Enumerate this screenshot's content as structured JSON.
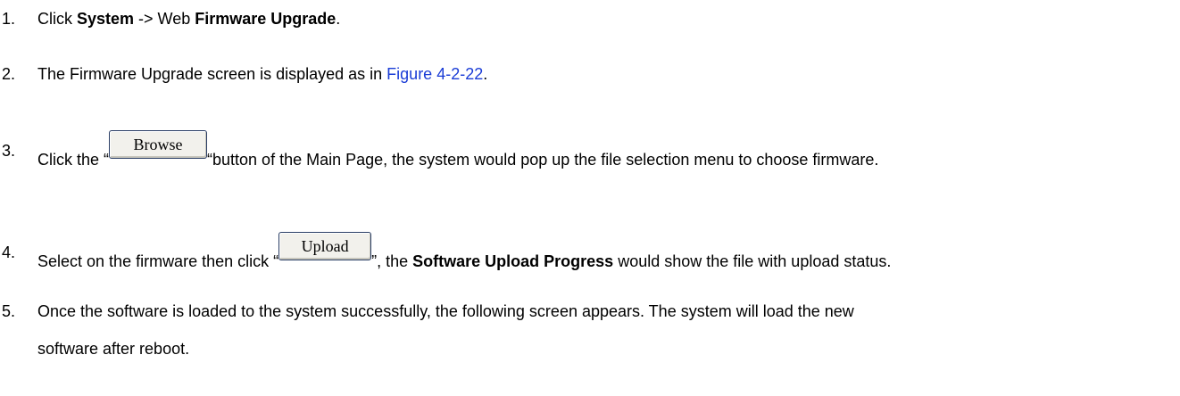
{
  "steps": [
    {
      "number": "1.",
      "text_a": "Click ",
      "bold_a": "System",
      "text_b": " -> Web ",
      "bold_b": "Firmware Upgrade",
      "text_c": "."
    },
    {
      "number": "2.",
      "text_a": "The Firmware Upgrade screen is displayed as in ",
      "link": "Figure 4-2-22",
      "text_b": "."
    },
    {
      "number": "3.",
      "text_a": "Click the “",
      "button_label": "Browse",
      "text_b": "“button of the Main Page, the system would pop up the file selection menu to choose firmware."
    },
    {
      "number": "4.",
      "text_a": "Select on the firmware then click “",
      "button_label": "Upload",
      "text_b": "”, the ",
      "bold": "Software Upload Progress",
      "text_c": " would show the file with upload status."
    },
    {
      "number": "5.",
      "line1": "Once the software is loaded to the system successfully, the following screen appears. The system will load the new",
      "line2": "software after reboot."
    }
  ],
  "colors": {
    "link": "#1a3cd6",
    "text": "#000000"
  }
}
